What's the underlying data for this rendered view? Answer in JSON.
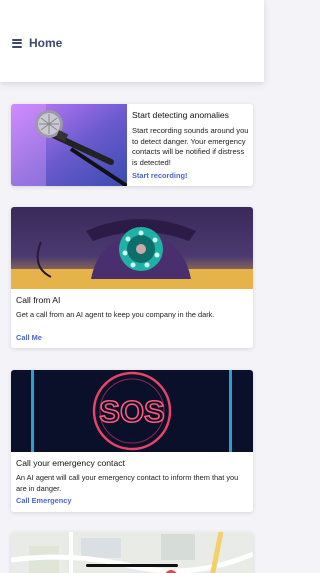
{
  "header": {
    "title": "Home",
    "menu_icon": "hamburger-icon"
  },
  "cards": [
    {
      "title": "Start detecting anomalies",
      "description": "Start recording sounds around you to detect danger. Your emergency contacts will be notified if distress is detected!",
      "action": "Start recording!",
      "image": "microphone-image"
    },
    {
      "title": "Call from AI",
      "description": "Get a call from an AI agent to keep you company in the dark.",
      "action": "Call Me",
      "image": "telephone-image"
    },
    {
      "title": "Call your emergency contact",
      "description": "An AI agent will call your emergency contact to inform them that you are in danger.",
      "action": "Call Emergency",
      "image": "sos-neon-image",
      "image_text": "SOS"
    },
    {
      "image": "map-image"
    }
  ],
  "colors": {
    "accent": "#4d67c8",
    "header_text": "#3b4a6b",
    "background": "#f3f3f8"
  }
}
